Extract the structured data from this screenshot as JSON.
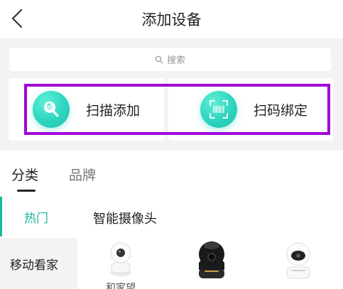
{
  "header": {
    "title": "添加设备",
    "back_icon": "back-arrow-icon"
  },
  "search": {
    "placeholder": "搜索",
    "icon": "search-icon"
  },
  "actions": [
    {
      "label": "扫描添加",
      "icon": "magnifier-scan-icon"
    },
    {
      "label": "扫码绑定",
      "icon": "barcode-scan-icon"
    }
  ],
  "tabs": [
    {
      "label": "分类",
      "active": true
    },
    {
      "label": "品牌",
      "active": false
    }
  ],
  "sidebar": {
    "items": [
      {
        "label": "热门",
        "active": true
      },
      {
        "label": "移动看家",
        "active": false
      }
    ]
  },
  "section": {
    "title": "智能摄像头",
    "products": [
      {
        "label": "和家望",
        "icon": "white-dome-camera-icon"
      },
      {
        "icon": "black-dome-camera-icon"
      },
      {
        "icon": "white-pan-tilt-camera-icon"
      }
    ]
  },
  "colors": {
    "accent": "#19b89e",
    "highlight": "#a000d8",
    "icon_gradient": "#2dd4bf"
  }
}
